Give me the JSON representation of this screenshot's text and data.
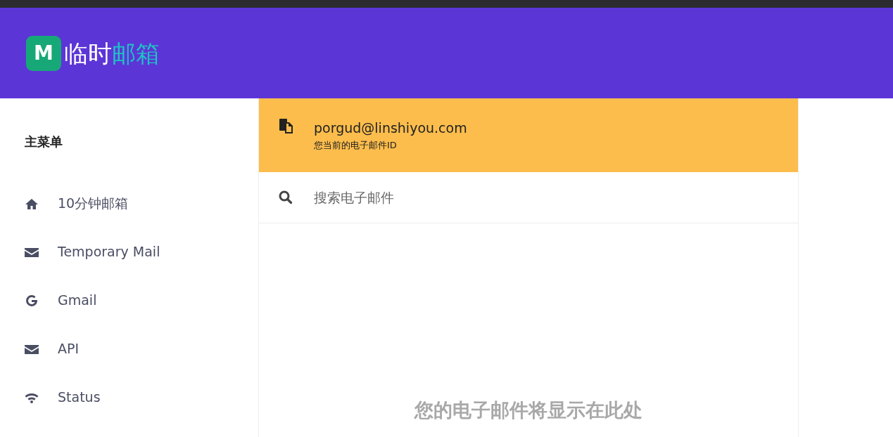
{
  "header": {
    "logo_mark": "M",
    "logo_text_1": "临时",
    "logo_text_2": "邮箱"
  },
  "sidebar": {
    "title": "主菜单",
    "items": [
      {
        "kind": "home",
        "label": "10分钟邮箱"
      },
      {
        "kind": "envelope",
        "label": "Temporary Mail"
      },
      {
        "kind": "google",
        "label": "Gmail"
      },
      {
        "kind": "envelope",
        "label": "API"
      },
      {
        "kind": "wifi",
        "label": "Status"
      }
    ]
  },
  "email_card": {
    "address": "porgud@linshiyou.com",
    "caption": "您当前的电子邮件ID"
  },
  "search": {
    "placeholder": "搜索电子邮件"
  },
  "inbox": {
    "empty_message": "您的电子邮件将显示在此处"
  }
}
